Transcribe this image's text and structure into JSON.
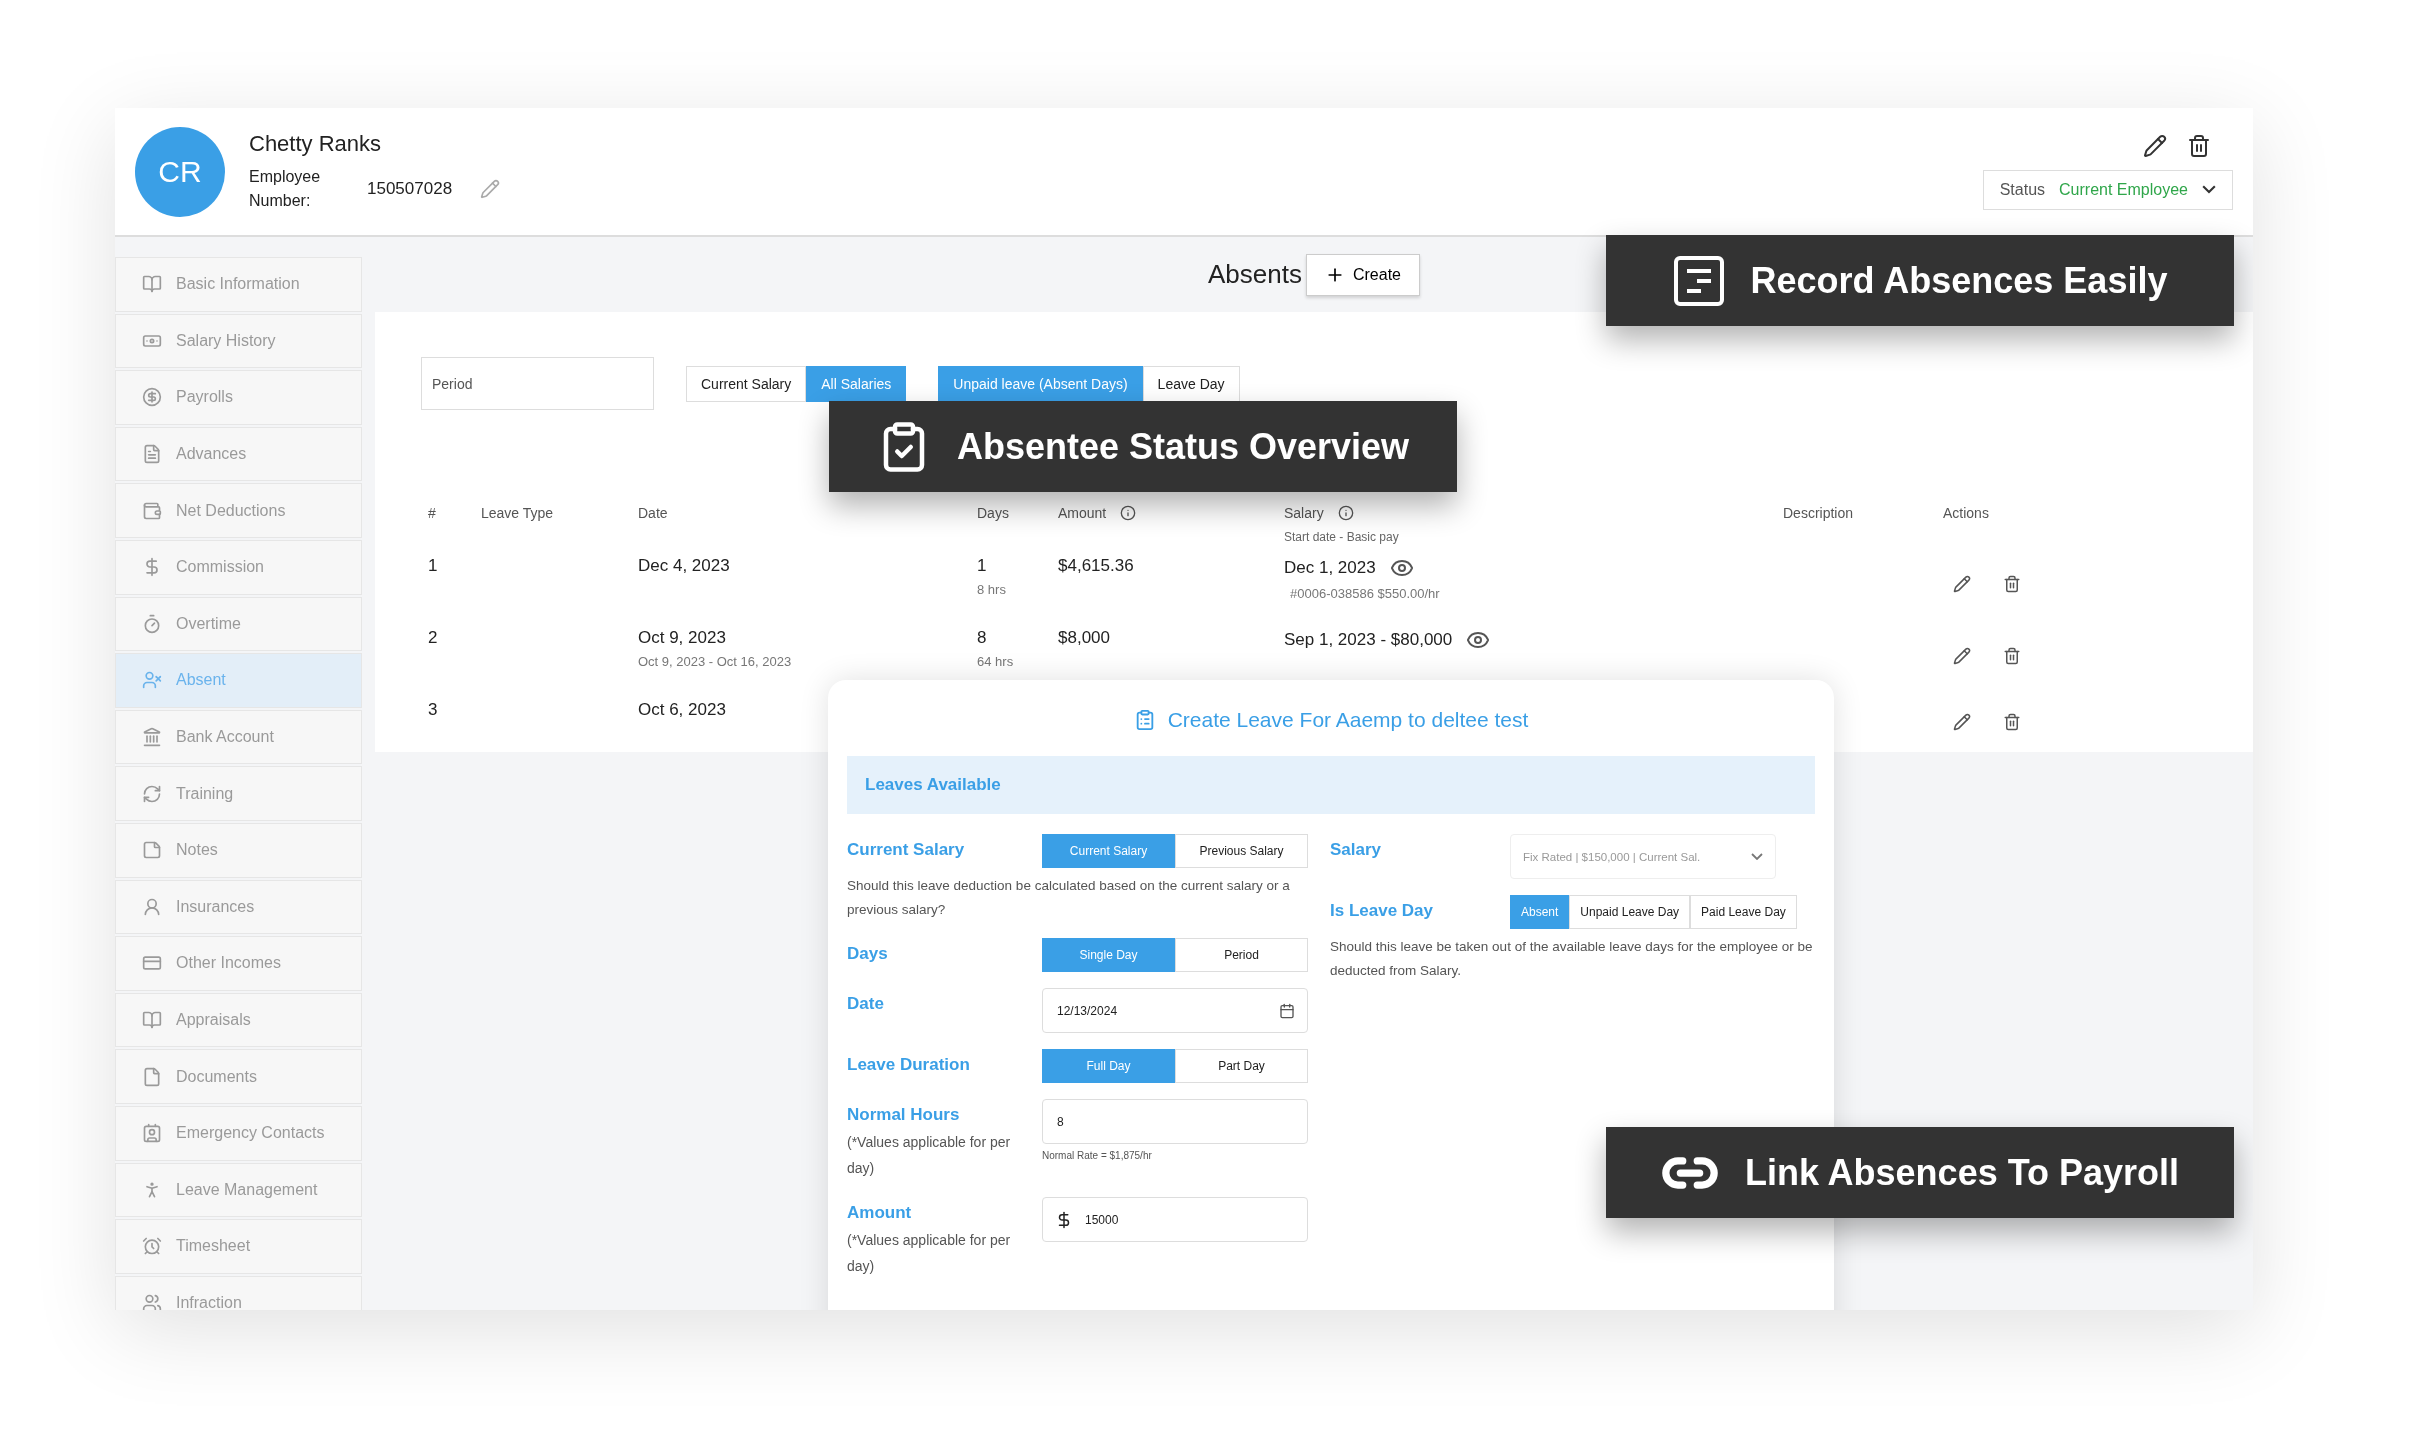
{
  "employee": {
    "initials": "CR",
    "name": "Chetty Ranks",
    "number_label": "Employee Number:",
    "number": "150507028",
    "status_label": "Status",
    "status": "Current Employee"
  },
  "sidebar": {
    "items": [
      {
        "label": "Basic Information",
        "selected": false
      },
      {
        "label": "Salary History",
        "selected": false
      },
      {
        "label": "Payrolls",
        "selected": false
      },
      {
        "label": "Advances",
        "selected": false
      },
      {
        "label": "Net Deductions",
        "selected": false
      },
      {
        "label": "Commission",
        "selected": false
      },
      {
        "label": "Overtime",
        "selected": false
      },
      {
        "label": "Absent",
        "selected": true
      },
      {
        "label": "Bank Account",
        "selected": false
      },
      {
        "label": "Training",
        "selected": false
      },
      {
        "label": "Notes",
        "selected": false
      },
      {
        "label": "Insurances",
        "selected": false
      },
      {
        "label": "Other Incomes",
        "selected": false
      },
      {
        "label": "Appraisals",
        "selected": false
      },
      {
        "label": "Documents",
        "selected": false
      },
      {
        "label": "Emergency Contacts",
        "selected": false
      },
      {
        "label": "Leave Management",
        "selected": false
      },
      {
        "label": "Timesheet",
        "selected": false
      },
      {
        "label": "Infraction",
        "selected": false
      }
    ]
  },
  "absents": {
    "title": "Absents",
    "create_button": "Create"
  },
  "filters": {
    "period_placeholder": "Period",
    "salary_toggle": [
      {
        "label": "Current Salary",
        "selected": false
      },
      {
        "label": "All Salaries",
        "selected": true
      }
    ],
    "leave_toggle": [
      {
        "label": "Unpaid leave (Absent Days)",
        "selected": true
      },
      {
        "label": "Leave Day",
        "selected": false
      }
    ]
  },
  "table": {
    "columns": [
      "#",
      "Leave Type",
      "Date",
      "Days",
      "Amount",
      "Salary",
      "Description",
      "Actions"
    ],
    "salary_subheading": "Start date - Basic pay",
    "rows": [
      {
        "index": "1",
        "date": "Dec 4, 2023",
        "days": "1",
        "hours": "8 hrs",
        "amount": "$4,615.36",
        "salary": "Dec 1, 2023",
        "salary_detail": "#0006-038586 $550.00/hr"
      },
      {
        "index": "2",
        "date": "Oct 9, 2023",
        "date_range": "Oct 9, 2023 - Oct 16, 2023",
        "days": "8",
        "hours": "64 hrs",
        "amount": "$8,000",
        "salary": "Sep 1, 2023 - $80,000"
      },
      {
        "index": "3",
        "date": "Oct 6, 2023"
      }
    ]
  },
  "modal": {
    "title": "Create Leave For Aaemp to deltee test",
    "leaves_available": "Leaves Available",
    "left": [
      {
        "kind": "toggle",
        "label": "Current Salary",
        "options": [
          {
            "label": "Current Salary",
            "selected": true
          },
          {
            "label": "Previous Salary",
            "selected": false
          }
        ],
        "help": "Should this leave deduction be calculated based on the current salary or a previous salary?"
      },
      {
        "kind": "toggle",
        "label": "Days",
        "options": [
          {
            "label": "Single Day",
            "selected": true
          },
          {
            "label": "Period",
            "selected": false
          }
        ]
      },
      {
        "kind": "date",
        "label": "Date",
        "value": "12/13/2024"
      },
      {
        "kind": "toggle",
        "label": "Leave Duration",
        "options": [
          {
            "label": "Full Day",
            "selected": true
          },
          {
            "label": "Part Day",
            "selected": false
          }
        ]
      },
      {
        "kind": "number",
        "label": "Normal Hours",
        "note": "(*Values applicable for per day)",
        "value": "8",
        "hint": "Normal Rate = $1,875/hr"
      },
      {
        "kind": "currency",
        "label": "Amount",
        "note": "(*Values applicable for per day)",
        "value": "15000"
      }
    ],
    "right": [
      {
        "kind": "select",
        "label": "Salary",
        "value": "Fix Rated | $150,000 | Current Sal."
      },
      {
        "kind": "toggle",
        "label": "Is Leave Day",
        "options": [
          {
            "label": "Absent",
            "selected": true
          },
          {
            "label": "Unpaid Leave Day",
            "selected": false
          },
          {
            "label": "Paid Leave Day",
            "selected": false
          }
        ],
        "help": "Should this leave be taken out of the available leave days for the employee or be deducted from Salary."
      }
    ]
  },
  "callouts": [
    {
      "kind": "record",
      "text": "Record Absences Easily"
    },
    {
      "kind": "overview",
      "text": "Absentee Status Overview"
    },
    {
      "kind": "link",
      "text": "Link Absences To Payroll"
    }
  ]
}
